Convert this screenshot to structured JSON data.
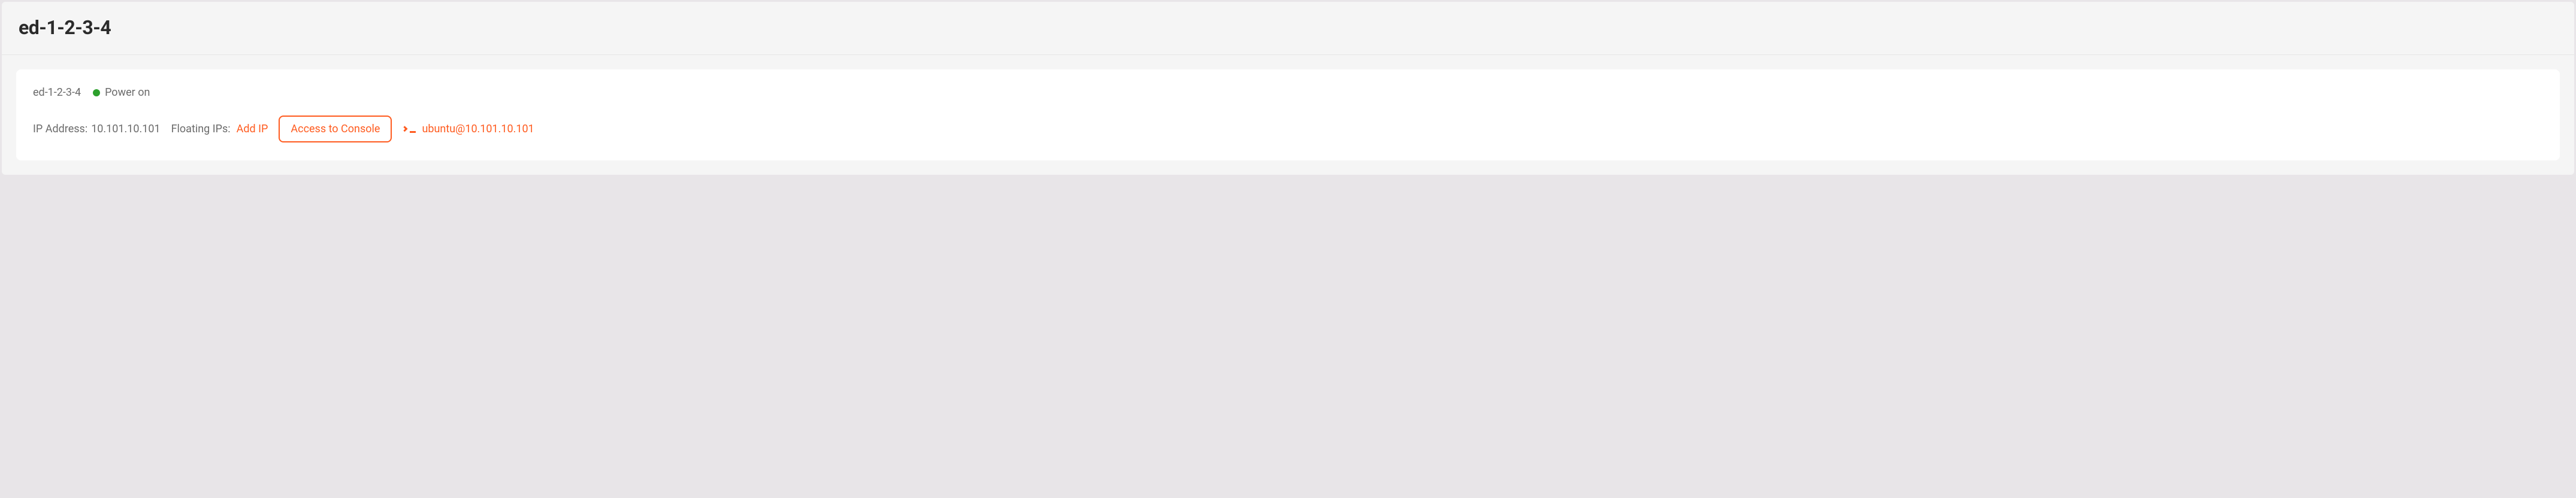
{
  "header": {
    "title": "ed-1-2-3-4"
  },
  "instance": {
    "name": "ed-1-2-3-4",
    "status_label": "Power on",
    "status_color": "#2ca02c"
  },
  "network": {
    "ip_label": "IP Address:",
    "ip_value": "10.101.10.101",
    "floating_label": "Floating IPs:",
    "add_ip_label": "Add IP"
  },
  "actions": {
    "console_label": "Access to Console",
    "ssh_connection": "ubuntu@10.101.10.101"
  },
  "colors": {
    "accent": "#ff5b1f",
    "status_ok": "#2ca02c",
    "text_muted": "#6b6b6b",
    "text_dark": "#2b2b2b"
  }
}
